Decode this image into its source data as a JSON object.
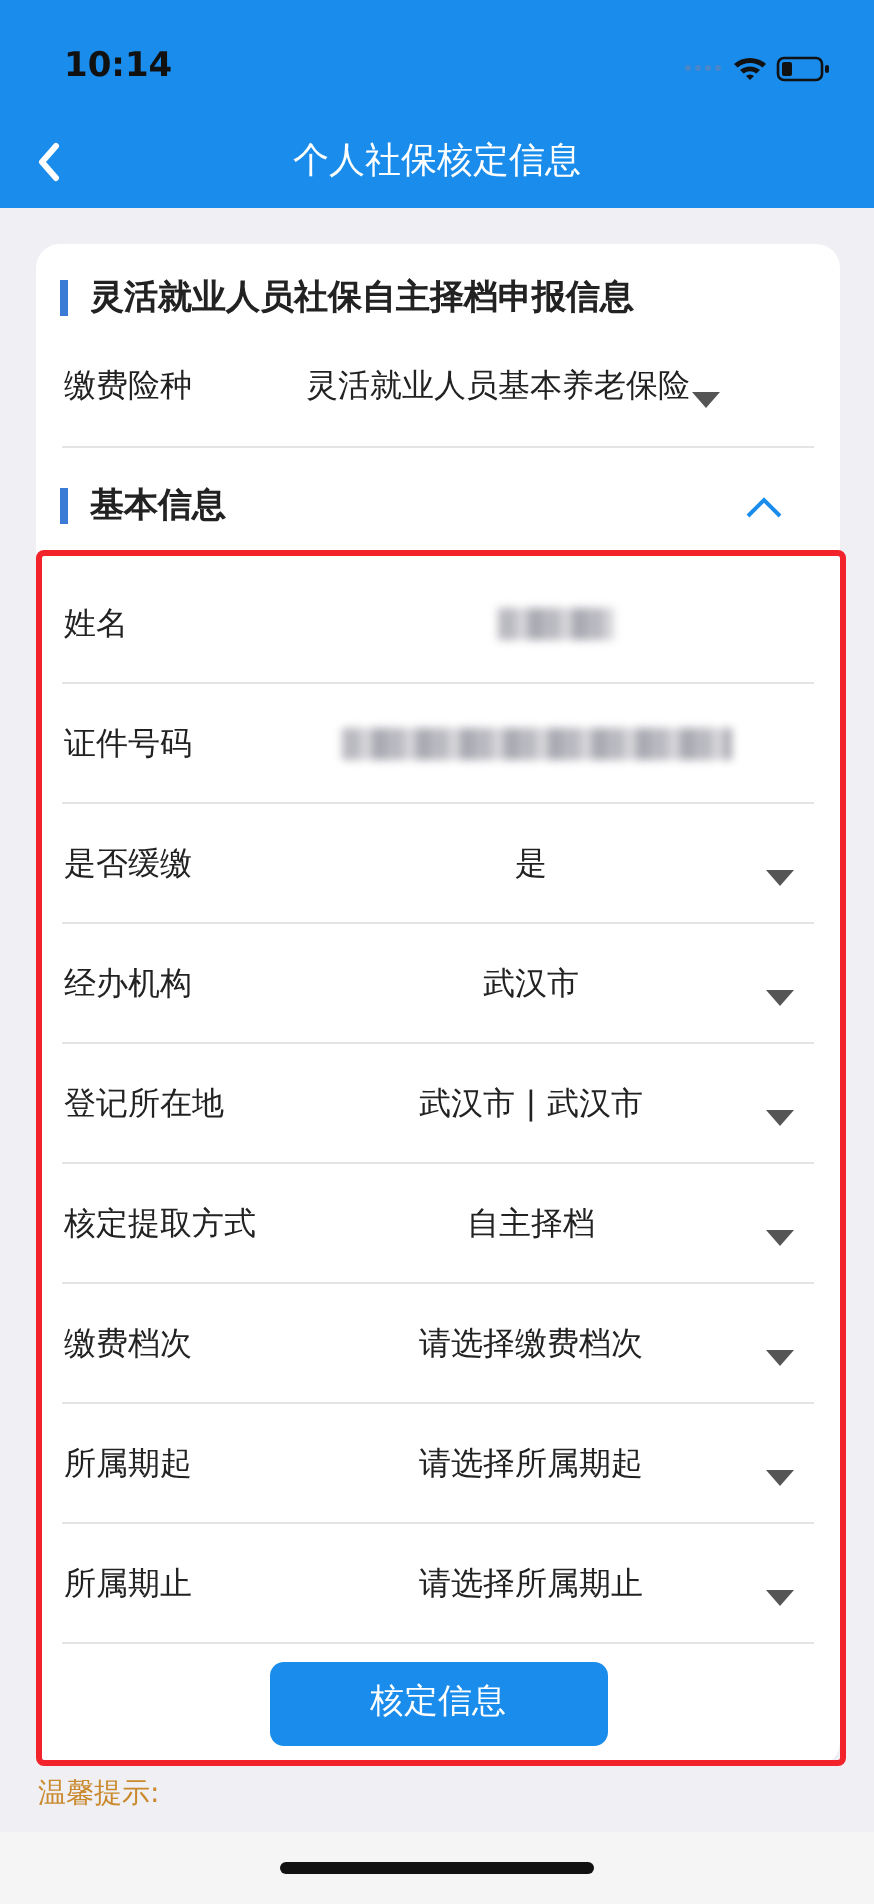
{
  "status_bar": {
    "time": "10:14"
  },
  "nav": {
    "title": "个人社保核定信息"
  },
  "form_title": "灵活就业人员社保自主择档申报信息",
  "insurance_type": {
    "label": "缴费险种",
    "value": "灵活就业人员基本养老保险"
  },
  "basic_section": {
    "title": "基本信息",
    "expanded": true
  },
  "rows": [
    {
      "kind": "redacted",
      "label": "姓名"
    },
    {
      "kind": "redacted",
      "label": "证件号码"
    },
    {
      "kind": "select",
      "label": "是否缓缴",
      "value": "是"
    },
    {
      "kind": "select",
      "label": "经办机构",
      "value": "武汉市"
    },
    {
      "kind": "select",
      "label": "登记所在地",
      "value": "武汉市 | 武汉市"
    },
    {
      "kind": "select",
      "label": "核定提取方式",
      "value": "自主择档"
    },
    {
      "kind": "select",
      "label": "缴费档次",
      "value": "请选择缴费档次"
    },
    {
      "kind": "select",
      "label": "所属期起",
      "value": "请选择所属期起"
    },
    {
      "kind": "select",
      "label": "所属期止",
      "value": "请选择所属期止"
    }
  ],
  "submit_button": "核定信息",
  "tip": "温馨提示:"
}
